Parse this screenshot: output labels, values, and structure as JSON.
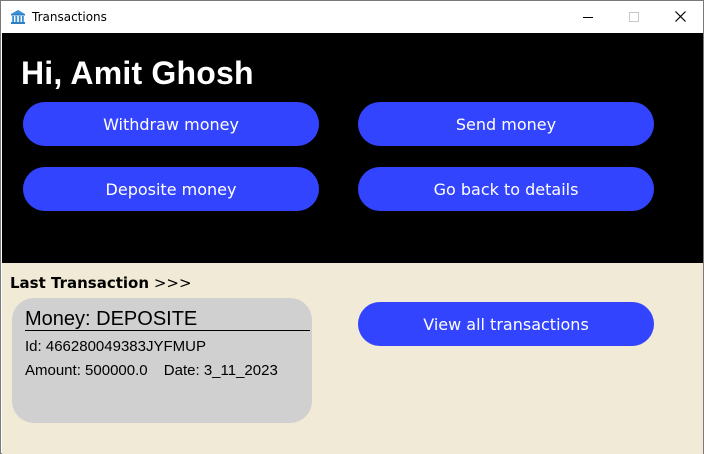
{
  "window": {
    "title": "Transactions",
    "icon": "bank-icon",
    "controls": [
      "minimize-icon",
      "maximize-icon",
      "close-icon"
    ]
  },
  "header": {
    "greeting": "Hi, Amit Ghosh"
  },
  "actions": {
    "withdraw_label": "Withdraw money",
    "send_label": "Send money",
    "deposit_label": "Deposite money",
    "details_label": "Go back to details"
  },
  "last_transaction": {
    "label": "Last Transaction",
    "arrows": ">>>",
    "money_type": "Money: DEPOSITE",
    "id_label": "Id:",
    "id_value": "466280049383JYFMUP",
    "amount_label": "Amount:",
    "amount_value": "500000.0",
    "date_label": "Date:",
    "date_value": "3_11_2023",
    "view_all_label": "View all transactions"
  },
  "colors": {
    "accent": "#3344ff",
    "top_background": "#000000",
    "bottom_background": "#f1ead6",
    "card_background": "#d0d0d0"
  }
}
